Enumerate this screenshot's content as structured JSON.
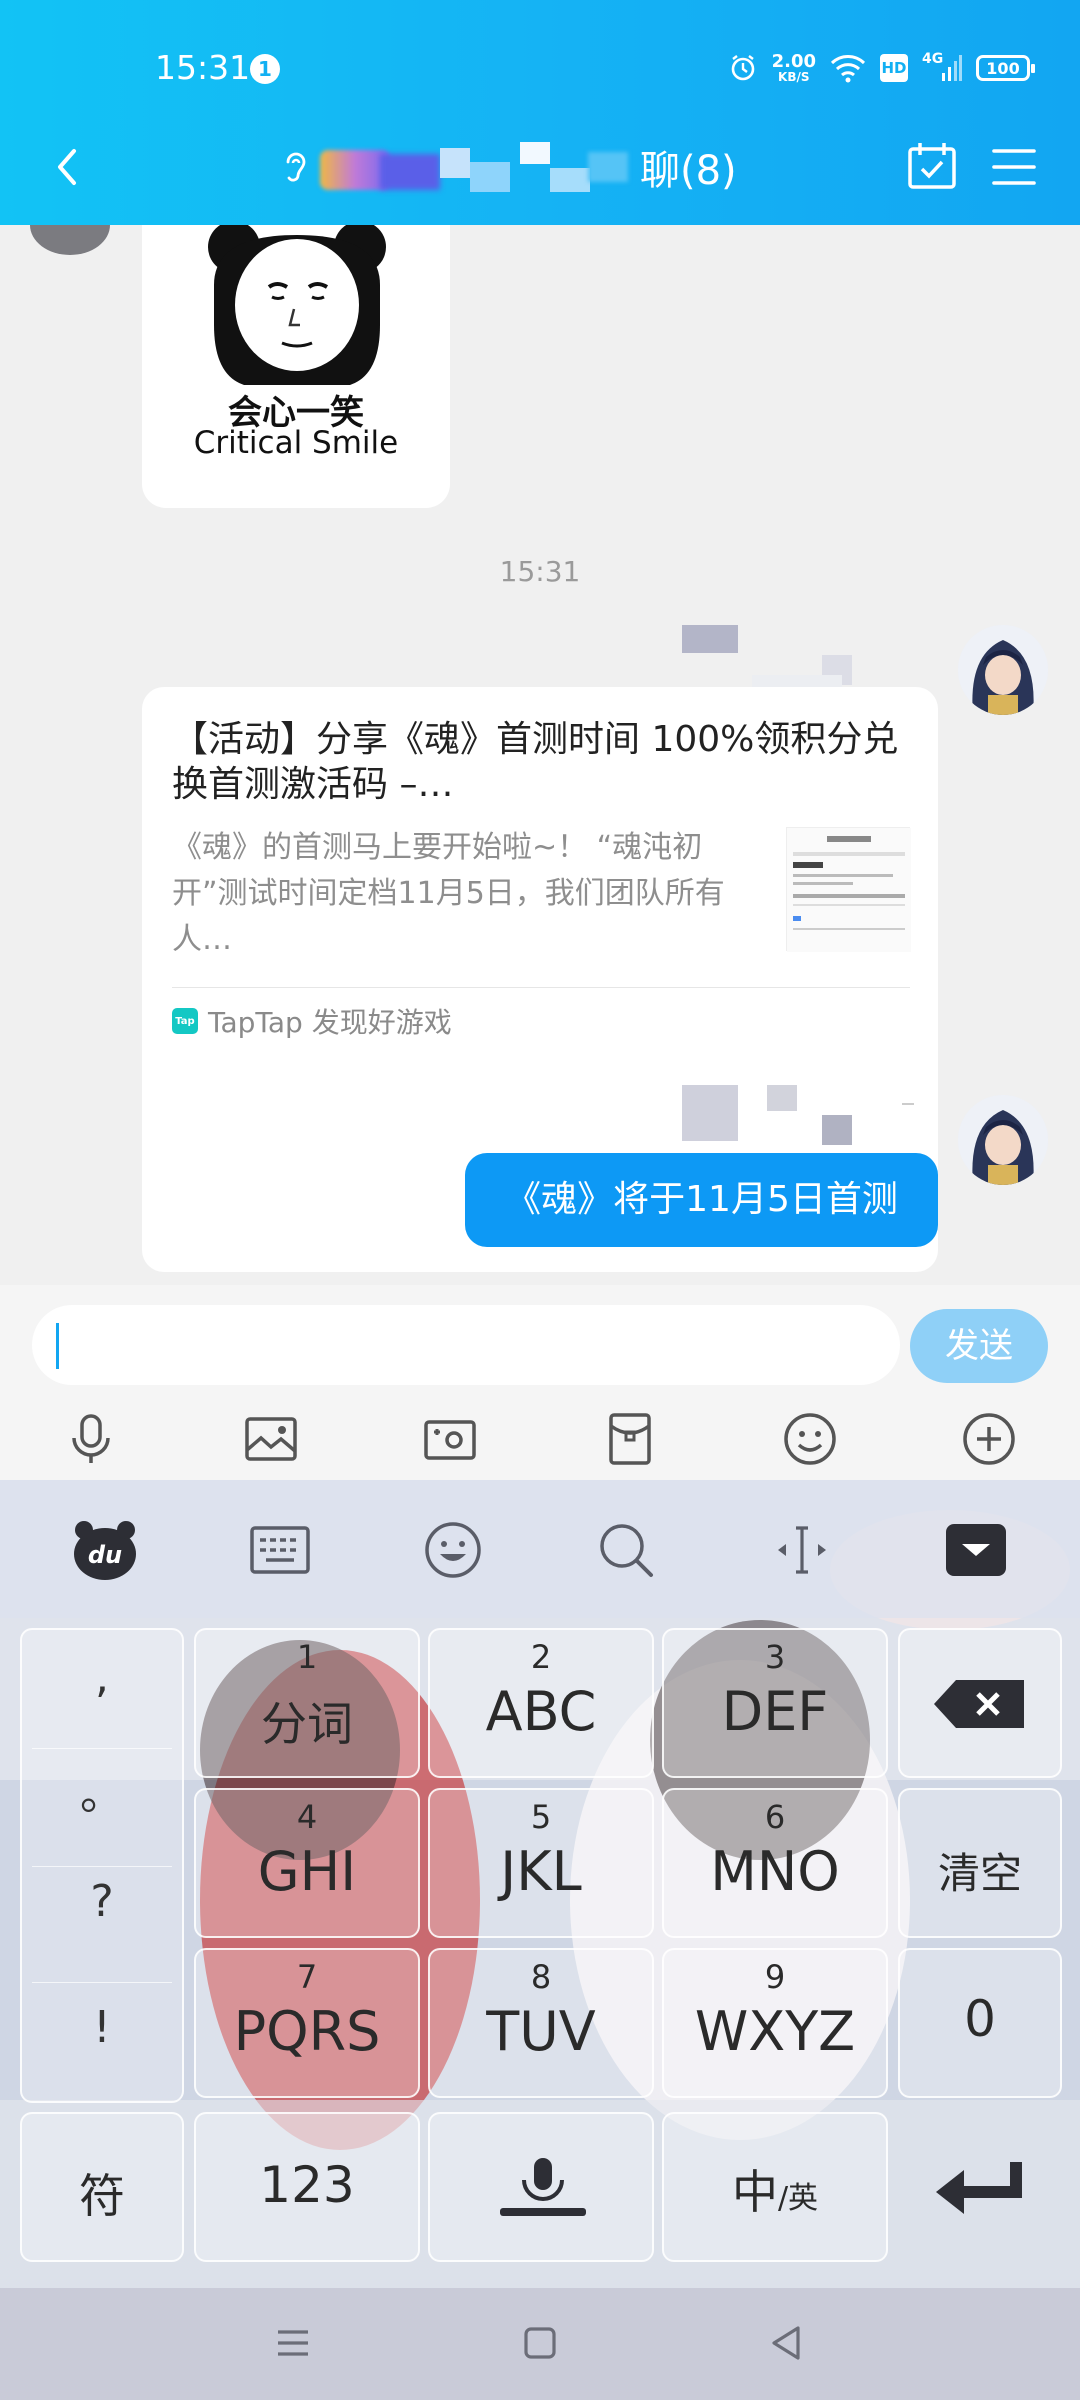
{
  "status_bar": {
    "time": "15:31",
    "notification_count": "1",
    "net_speed_value": "2.00",
    "net_speed_unit": "KB/S",
    "hd_label": "HD",
    "network_type": "4G",
    "battery_level": "100"
  },
  "header": {
    "group_title_suffix": "聊(8)",
    "accent_color": "#12b0f3"
  },
  "chat": {
    "sticker": {
      "caption_cn": "会心一笑",
      "caption_en": "Critical Smile"
    },
    "timestamp": "15:31",
    "share_card": {
      "title": "【活动】分享《魂》首测时间 100%领积分兑换首测激活码 –…",
      "description": "《魂》的首测马上要开始啦~！ “魂沌初开”测试时间定档11月5日，我们团队所有人…",
      "source_label": "TapTap 发现好游戏",
      "source_logo_text": "Tap"
    },
    "my_message": "《魂》将于11月5日首测"
  },
  "input_bar": {
    "text_value": "",
    "send_label": "发送",
    "tools": [
      "microphone-icon",
      "image-icon",
      "camera-icon",
      "red-envelope-icon",
      "emoji-icon",
      "plus-icon"
    ]
  },
  "keyboard": {
    "logo_text": "du",
    "punctuation": [
      ",",
      "。",
      "?",
      "!"
    ],
    "keys": [
      {
        "num": "1",
        "label": "分词"
      },
      {
        "num": "2",
        "label": "ABC"
      },
      {
        "num": "3",
        "label": "DEF"
      },
      {
        "num": "4",
        "label": "GHI"
      },
      {
        "num": "5",
        "label": "JKL"
      },
      {
        "num": "6",
        "label": "MNO"
      },
      {
        "num": "7",
        "label": "PQRS"
      },
      {
        "num": "8",
        "label": "TUV"
      },
      {
        "num": "9",
        "label": "WXYZ"
      }
    ],
    "clear_label": "清空",
    "zero_label": "0",
    "symbol_label": "符",
    "numeric_label": "123",
    "lang_main": "中",
    "lang_alt": "/英"
  }
}
